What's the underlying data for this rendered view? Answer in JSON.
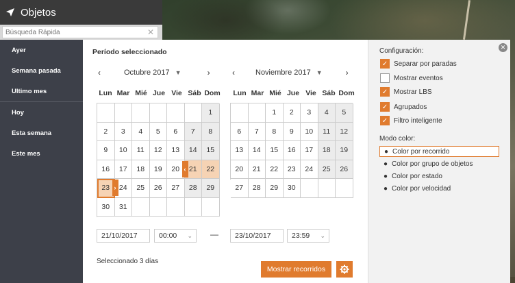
{
  "topbar": {
    "title": "Objetos",
    "icon": "navigation-arrow-icon"
  },
  "search": {
    "placeholder": "Búsqueda Rápida"
  },
  "sidebar": {
    "items": [
      {
        "label": "Ayer"
      },
      {
        "label": "Semana pasada"
      },
      {
        "label": "Ultimo mes"
      },
      {
        "label": "Hoy"
      },
      {
        "label": "Esta semana"
      },
      {
        "label": "Este mes"
      }
    ]
  },
  "main": {
    "title": "Período seleccionado",
    "weekdays": [
      "Lun",
      "Mar",
      "Mié",
      "Jue",
      "Vie",
      "Sáb",
      "Dom"
    ],
    "calendars": [
      {
        "month": "Octubre 2017",
        "rows": [
          [
            "",
            "",
            "",
            "",
            "",
            "",
            "1"
          ],
          [
            "2",
            "3",
            "4",
            "5",
            "6",
            "7",
            "8"
          ],
          [
            "9",
            "10",
            "11",
            "12",
            "13",
            "14",
            "15"
          ],
          [
            "16",
            "17",
            "18",
            "19",
            "20",
            "21",
            "22"
          ],
          [
            "23",
            "24",
            "25",
            "26",
            "27",
            "28",
            "29"
          ],
          [
            "30",
            "31",
            "",
            "",
            "",
            "",
            ""
          ]
        ]
      },
      {
        "month": "Noviembre 2017",
        "rows": [
          [
            "",
            "",
            "1",
            "2",
            "3",
            "4",
            "5"
          ],
          [
            "6",
            "7",
            "8",
            "9",
            "10",
            "11",
            "12"
          ],
          [
            "13",
            "14",
            "15",
            "16",
            "17",
            "18",
            "19"
          ],
          [
            "20",
            "21",
            "22",
            "23",
            "24",
            "25",
            "26"
          ],
          [
            "27",
            "28",
            "29",
            "30",
            "",
            "",
            ""
          ]
        ]
      }
    ],
    "from_date": "21/10/2017",
    "from_time": "00:00",
    "to_date": "23/10/2017",
    "to_time": "23:59",
    "range_separator": "—",
    "selected_text": "Seleccionado 3 días",
    "show_button": "Mostrar recorridos"
  },
  "config": {
    "title": "Configuración:",
    "checkboxes": [
      {
        "label": "Separar por paradas",
        "checked": true
      },
      {
        "label": "Mostrar eventos",
        "checked": false
      },
      {
        "label": "Mostrar LBS",
        "checked": true
      },
      {
        "label": "Agrupados",
        "checked": true
      },
      {
        "label": "Filtro inteligente",
        "checked": true
      }
    ],
    "mode_title": "Modo color:",
    "modes": [
      {
        "label": "Color por recorrido",
        "active": true
      },
      {
        "label": "Color por grupo de objetos",
        "active": false
      },
      {
        "label": "Color por estado",
        "active": false
      },
      {
        "label": "Color por velocidad",
        "active": false
      }
    ]
  },
  "colors": {
    "accent": "#e07b2e",
    "range": "#f6d3b4",
    "weekend": "#ececec",
    "sidebar": "#3d4049"
  }
}
